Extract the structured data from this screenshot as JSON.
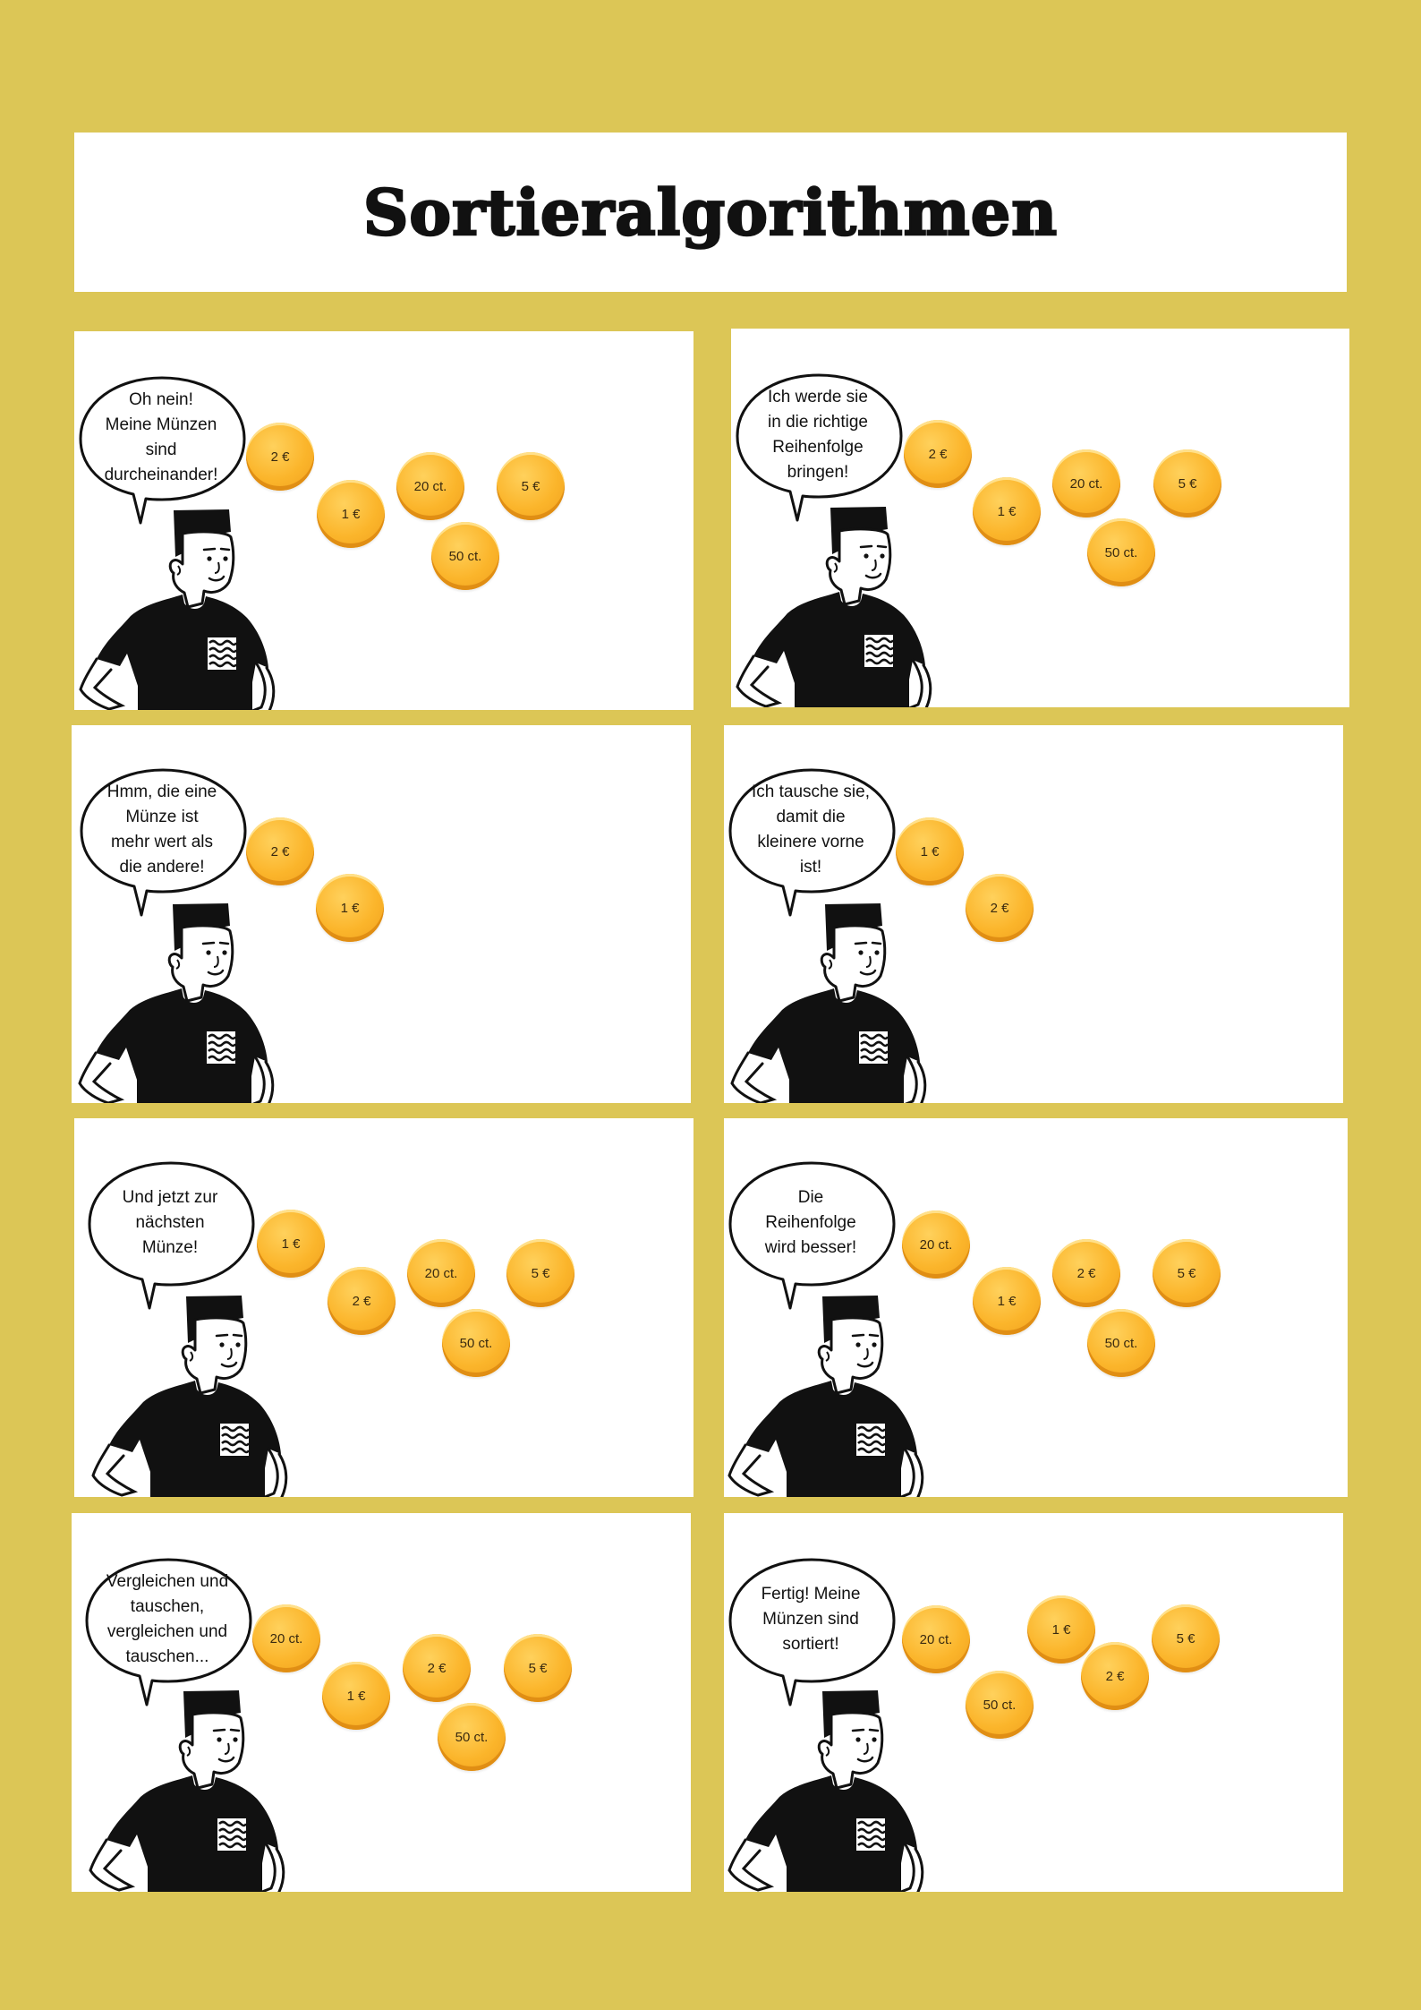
{
  "title": "Sortieralgorithmen",
  "colors": {
    "background": "#dcc656",
    "panel": "#ffffff",
    "coin": "#fbb52b",
    "ink": "#111111"
  },
  "panels": [
    {
      "speech": "Oh nein!\nMeine Münzen\nsind\ndurcheinander!",
      "coins": [
        "2 €",
        "1 €",
        "20 ct.",
        "50 ct.",
        "5 €"
      ]
    },
    {
      "speech": "Ich werde sie\nin die richtige\nReihenfolge\nbringen!",
      "coins": [
        "2 €",
        "1 €",
        "20 ct.",
        "50 ct.",
        "5 €"
      ]
    },
    {
      "speech": "Hmm, die eine\nMünze ist\nmehr wert als\ndie andere!",
      "coins": [
        "2 €",
        "1 €"
      ]
    },
    {
      "speech": "Ich tausche sie,\ndamit die\nkleinere vorne\nist!",
      "coins": [
        "1 €",
        "2 €"
      ]
    },
    {
      "speech": "Und jetzt zur\nnächsten\nMünze!",
      "coins": [
        "1 €",
        "2 €",
        "20 ct.",
        "50 ct.",
        "5 €"
      ]
    },
    {
      "speech": "Die\nReihenfolge\nwird besser!",
      "coins": [
        "20 ct.",
        "1 €",
        "2 €",
        "50 ct.",
        "5 €"
      ]
    },
    {
      "speech": "Vergleichen und\ntauschen,\nvergleichen und\ntauschen...",
      "coins": [
        "20 ct.",
        "1 €",
        "2 €",
        "50 ct.",
        "5 €"
      ]
    },
    {
      "speech": "Fertig! Meine\nMünzen sind\nsortiert!",
      "coins": [
        "20 ct.",
        "50 ct.",
        "1 €",
        "2 €",
        "5 €"
      ]
    }
  ]
}
